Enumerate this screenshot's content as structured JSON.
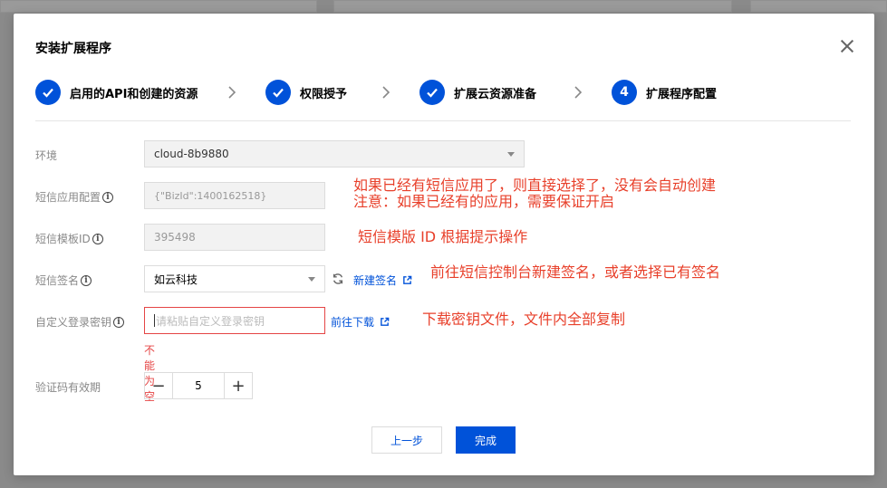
{
  "modal": {
    "title": "安装扩展程序"
  },
  "steps": [
    {
      "index": "1",
      "label": "启用的API和创建的资源",
      "status": "done"
    },
    {
      "index": "2",
      "label": "权限授予",
      "status": "done"
    },
    {
      "index": "3",
      "label": "扩展云资源准备",
      "status": "done"
    },
    {
      "index": "4",
      "label": "扩展程序配置",
      "status": "current"
    }
  ],
  "form": {
    "env": {
      "label": "环境",
      "value": "cloud-8b9880"
    },
    "sms_app": {
      "label": "短信应用配置",
      "value": "{\"BizId\":1400162518}"
    },
    "sms_template": {
      "label": "短信模板ID",
      "value": "395498"
    },
    "sms_sign": {
      "label": "短信签名",
      "value": "如云科技",
      "new_link": "新建签名"
    },
    "login_key": {
      "label": "自定义登录密钥",
      "placeholder": "请粘贴自定义登录密钥",
      "download_link": "前往下载",
      "error": "不能为空"
    },
    "code_ttl": {
      "label": "验证码有效期",
      "value": "5",
      "minus": "−",
      "plus": "+"
    }
  },
  "annotations": {
    "a1": "如果已经有短信应用了，则直接选择了，没有会自动创建",
    "a2": "注意：如果已经有的应用，需要保证开启",
    "a3": "短信模版 ID 根据提示操作",
    "a4": "前往短信控制台新建签名，或者选择已有签名",
    "a5": "下载密钥文件，文件内全部复制"
  },
  "footer": {
    "prev": "上一步",
    "done": "完成"
  },
  "colors": {
    "primary": "#0052d9",
    "error": "#e54545",
    "annotation": "#e8402b"
  }
}
